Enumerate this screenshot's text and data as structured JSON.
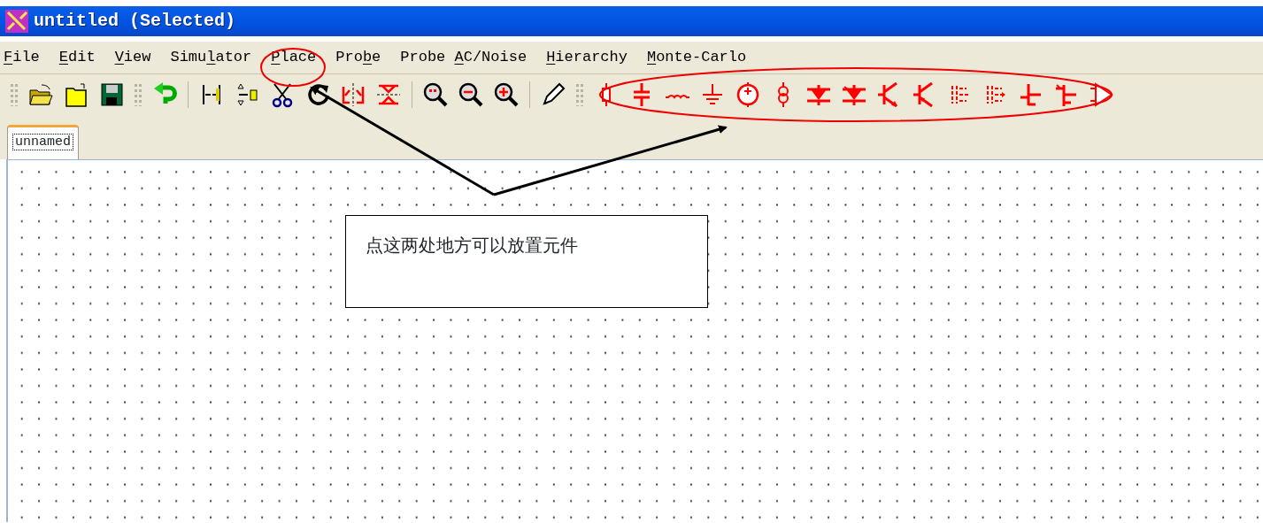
{
  "window": {
    "title": "untitled (Selected)"
  },
  "menu": [
    {
      "key": "F",
      "after": "ile"
    },
    {
      "key": "E",
      "after": "dit"
    },
    {
      "key": "V",
      "after": "iew"
    },
    {
      "before": "Simu",
      "key": "l",
      "after": "ator"
    },
    {
      "key": "P",
      "after": "lace"
    },
    {
      "before": "Pro",
      "key": "b",
      "after": "e"
    },
    {
      "before": "Probe ",
      "key": "A",
      "after": "C/Noise"
    },
    {
      "key": "H",
      "after": "ierarchy"
    },
    {
      "key": "M",
      "after": "onte-Carlo"
    }
  ],
  "tabs": [
    {
      "label": "unnamed",
      "selected": true
    }
  ],
  "annotation": {
    "text": "点这两处地方可以放置元件"
  }
}
